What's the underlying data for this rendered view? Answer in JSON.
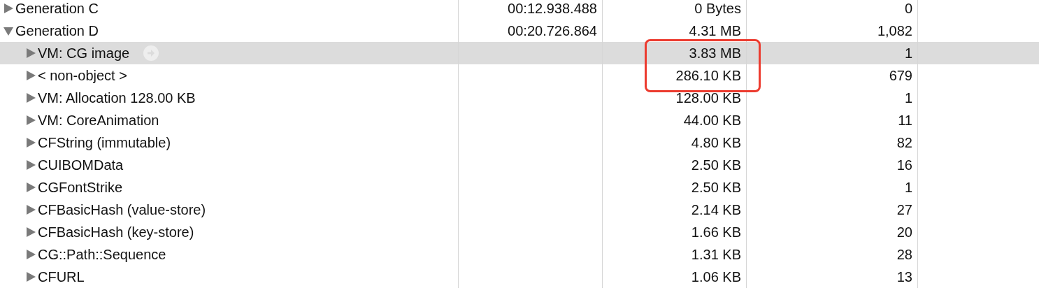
{
  "rows": [
    {
      "name": "Generation C",
      "timestamp": "00:12.938.488",
      "size": "0 Bytes",
      "count": "0",
      "expanded": false,
      "selected": false
    },
    {
      "name": "Generation D",
      "timestamp": "00:20.726.864",
      "size": "4.31 MB",
      "count": "1,082",
      "expanded": true,
      "selected": false,
      "children": [
        {
          "name": "VM: CG image",
          "size": "3.83 MB",
          "count": "1",
          "expanded": false,
          "selected": true
        },
        {
          "name": "< non-object >",
          "size": "286.10 KB",
          "count": "679",
          "expanded": false,
          "selected": false
        },
        {
          "name": "VM: Allocation 128.00 KB",
          "size": "128.00 KB",
          "count": "1",
          "expanded": false,
          "selected": false
        },
        {
          "name": "VM: CoreAnimation",
          "size": "44.00 KB",
          "count": "11",
          "expanded": false,
          "selected": false
        },
        {
          "name": "CFString (immutable)",
          "size": "4.80 KB",
          "count": "82",
          "expanded": false,
          "selected": false
        },
        {
          "name": "CUIBOMData",
          "size": "2.50 KB",
          "count": "16",
          "expanded": false,
          "selected": false
        },
        {
          "name": "CGFontStrike",
          "size": "2.50 KB",
          "count": "1",
          "expanded": false,
          "selected": false
        },
        {
          "name": "CFBasicHash (value-store)",
          "size": "2.14 KB",
          "count": "27",
          "expanded": false,
          "selected": false
        },
        {
          "name": "CFBasicHash (key-store)",
          "size": "1.66 KB",
          "count": "20",
          "expanded": false,
          "selected": false
        },
        {
          "name": "CG::Path::Sequence",
          "size": "1.31 KB",
          "count": "28",
          "expanded": false,
          "selected": false
        },
        {
          "name": "CFURL",
          "size": "1.06 KB",
          "count": "13",
          "expanded": false,
          "selected": false
        }
      ]
    }
  ],
  "highlight_box": true
}
